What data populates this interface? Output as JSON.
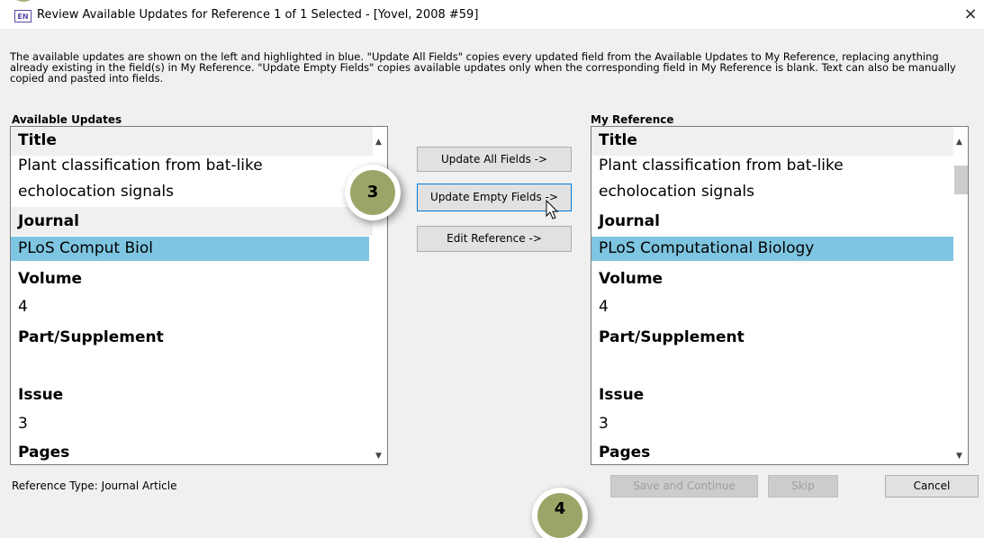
{
  "window": {
    "app_icon": "EN",
    "title": "Review Available Updates for Reference 1 of 1 Selected - [Yovel, 2008 #59]",
    "close_icon": "×"
  },
  "description": "The available updates are shown on the left and highlighted in blue. \"Update All Fields\" copies every updated field from the Available Updates to My Reference, replacing anything already existing in the field(s) in My Reference. \"Update Empty Fields\" copies available updates only when the corresponding field in My Reference is blank. Text can also be manually copied and pasted into fields.",
  "left_panel": {
    "header": "Available Updates",
    "title_label": "Title",
    "title_line1": "Plant classification from bat-like",
    "title_line2": "echolocation signals",
    "journal_label": "Journal",
    "journal_value": "PLoS Comput Biol",
    "volume_label": "Volume",
    "volume_value": "4",
    "part_label": "Part/Supplement",
    "issue_label": "Issue",
    "issue_value": "3",
    "pages_label": "Pages"
  },
  "right_panel": {
    "header": "My Reference",
    "title_label": "Title",
    "title_line1": "Plant classification from bat-like",
    "title_line2": "echolocation signals",
    "journal_label": "Journal",
    "journal_value": "PLoS Computational Biology",
    "volume_label": "Volume",
    "volume_value": "4",
    "part_label": "Part/Supplement",
    "issue_label": "Issue",
    "issue_value": "3",
    "pages_label": "Pages"
  },
  "buttons": {
    "update_all": "Update All Fields ->",
    "update_empty": "Update Empty Fields ->",
    "edit_reference": "Edit Reference ->",
    "save_continue": "Save and Continue",
    "skip": "Skip",
    "cancel": "Cancel"
  },
  "callouts": {
    "step3": "3",
    "step4": "4"
  },
  "footer": {
    "reference_type": "Reference Type: Journal Article"
  },
  "colors": {
    "highlight": "#7ec5e1",
    "callout": "#9aa668"
  }
}
